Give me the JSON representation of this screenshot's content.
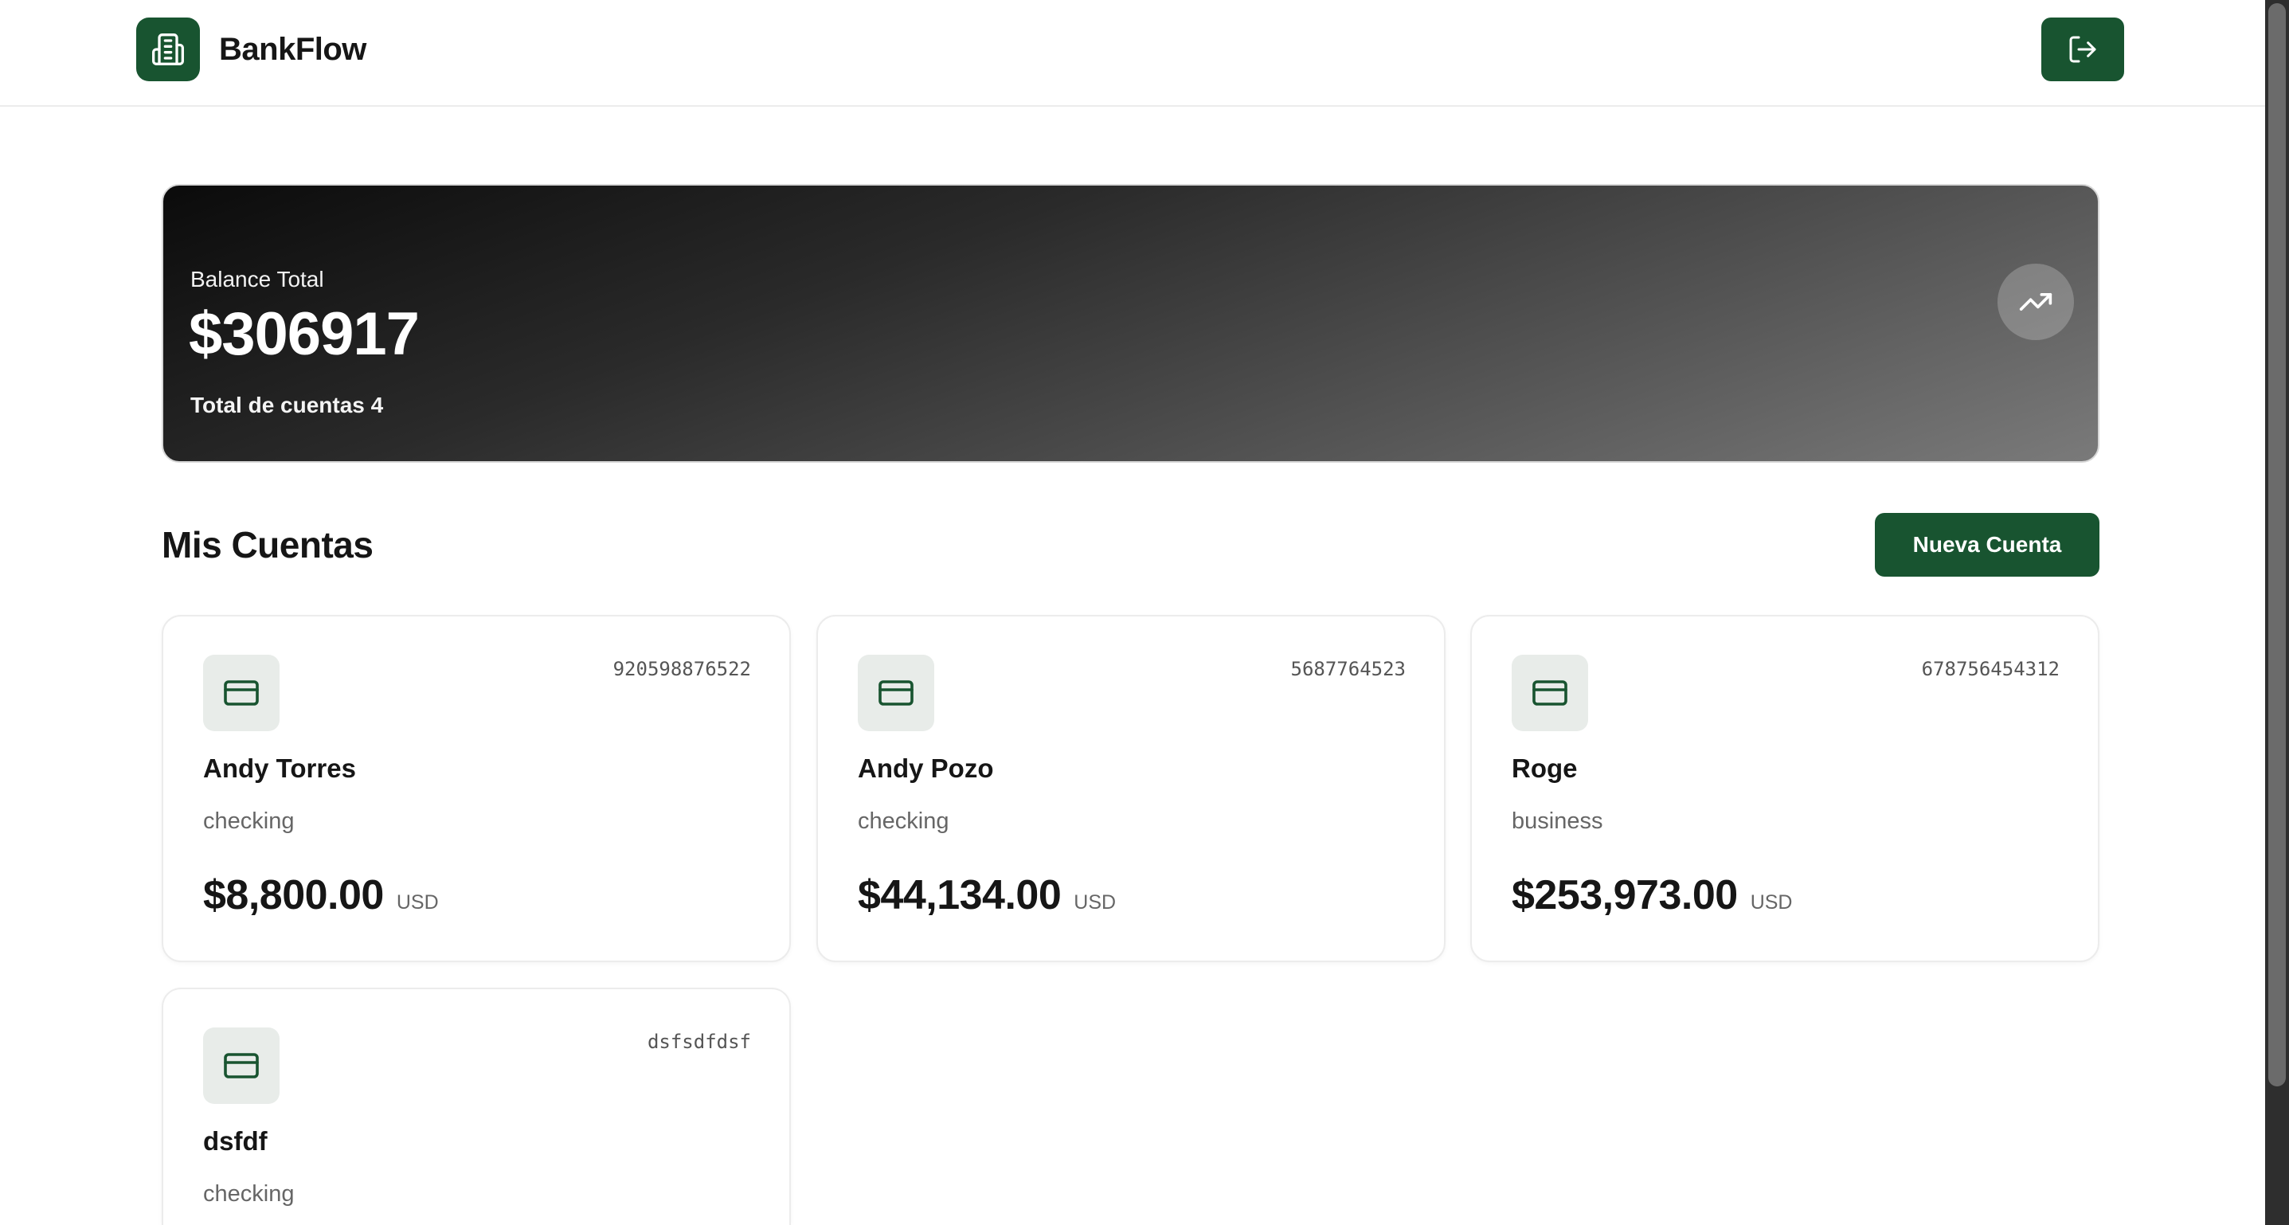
{
  "header": {
    "brand": "BankFlow",
    "logo_icon": "building-icon",
    "logout_icon": "logout-icon",
    "accent_color": "#185430"
  },
  "balance": {
    "label": "Balance Total",
    "amount": "$306917",
    "count_text": "Total de cuentas 4",
    "trend_icon": "trending-up-icon"
  },
  "accounts_section": {
    "title": "Mis Cuentas",
    "new_button": "Nueva Cuenta"
  },
  "accounts": [
    {
      "number": "920598876522",
      "name": "Andy Torres",
      "type": "checking",
      "amount": "$8,800.00",
      "currency": "USD",
      "icon": "credit-card-icon"
    },
    {
      "number": "5687764523",
      "name": "Andy Pozo",
      "type": "checking",
      "amount": "$44,134.00",
      "currency": "USD",
      "icon": "credit-card-icon"
    },
    {
      "number": "678756454312",
      "name": "Roge",
      "type": "business",
      "amount": "$253,973.00",
      "currency": "USD",
      "icon": "credit-card-icon"
    },
    {
      "number": "dsfsdfdsf",
      "name": "dsfdf",
      "type": "checking",
      "amount": "",
      "currency": "",
      "icon": "credit-card-icon"
    }
  ]
}
